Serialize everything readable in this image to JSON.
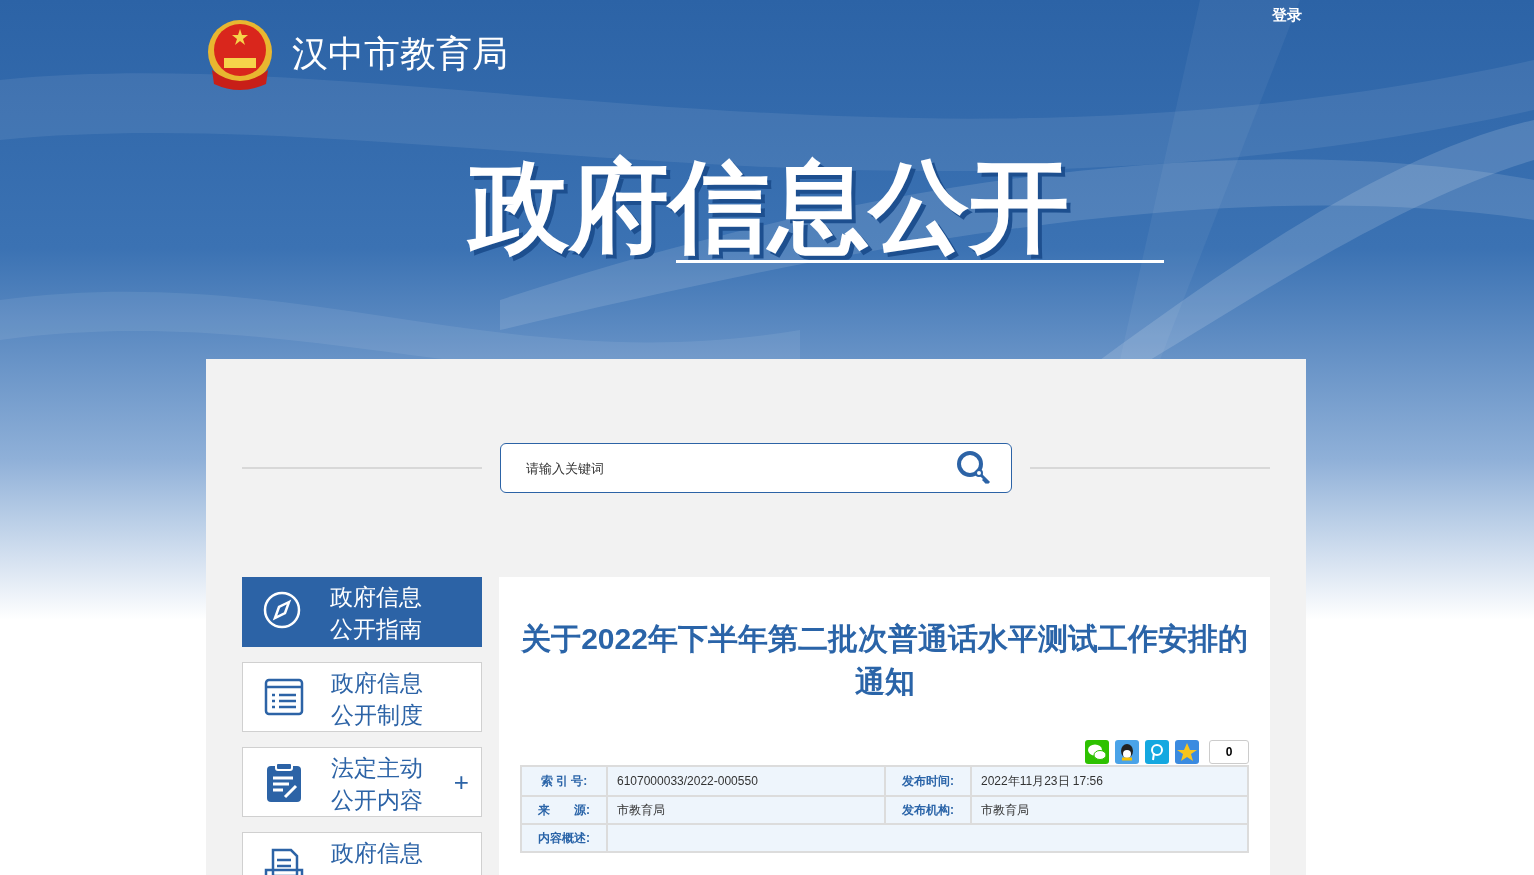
{
  "header": {
    "site_name": "汉中市教育局",
    "login": "登录",
    "banner_title": "政府信息公开"
  },
  "search": {
    "placeholder": "请输入关键词"
  },
  "sidebar": {
    "items": [
      {
        "kind": "compass",
        "lines": [
          "政府信息",
          "公开指南"
        ],
        "selected": true
      },
      {
        "kind": "list",
        "lines": [
          "政府信息",
          "公开制度"
        ],
        "selected": false
      },
      {
        "kind": "clipboard",
        "lines": [
          "法定主动",
          "公开内容"
        ],
        "selected": false,
        "expand_mark": "+"
      },
      {
        "kind": "document",
        "lines": [
          "政府信息"
        ],
        "selected": false
      }
    ]
  },
  "article": {
    "title": "关于2022年下半年第二批次普通话水平测试工作安排的通知",
    "share": {
      "buttons": [
        {
          "kind": "wechat"
        },
        {
          "kind": "qq"
        },
        {
          "kind": "pengyou"
        },
        {
          "kind": "qzone"
        }
      ],
      "count": "0"
    },
    "meta_rows": [
      [
        {
          "label": "索 引 号:",
          "value": "6107000033/2022-000550"
        },
        {
          "label": "发布时间:",
          "value": "2022年11月23日 17:56"
        }
      ],
      [
        {
          "label": "来　　源:",
          "value": "市教育局"
        },
        {
          "label": "发布机构:",
          "value": "市教育局"
        }
      ],
      [
        {
          "label": "内容概述:"
        }
      ]
    ]
  }
}
